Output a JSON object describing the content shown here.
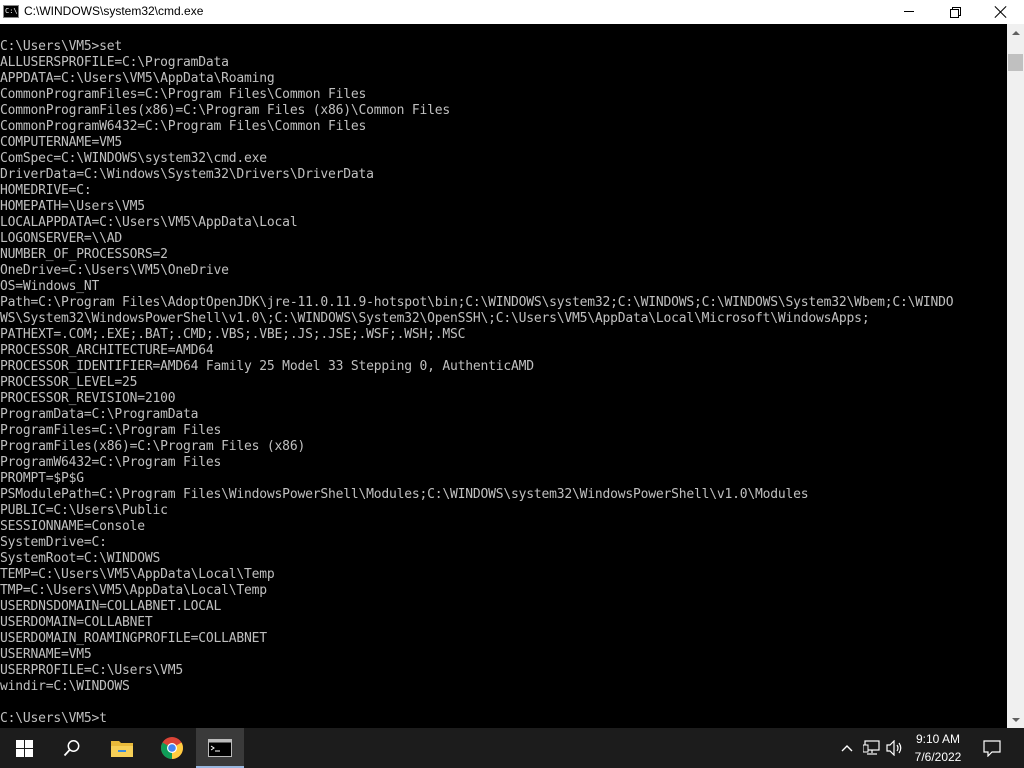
{
  "window": {
    "title": "C:\\WINDOWS\\system32\\cmd.exe",
    "icon": "cmd-icon",
    "icon_text": "C:\\"
  },
  "console": {
    "text": "C:\\Users\\VM5>set\nALLUSERSPROFILE=C:\\ProgramData\nAPPDATA=C:\\Users\\VM5\\AppData\\Roaming\nCommonProgramFiles=C:\\Program Files\\Common Files\nCommonProgramFiles(x86)=C:\\Program Files (x86)\\Common Files\nCommonProgramW6432=C:\\Program Files\\Common Files\nCOMPUTERNAME=VM5\nComSpec=C:\\WINDOWS\\system32\\cmd.exe\nDriverData=C:\\Windows\\System32\\Drivers\\DriverData\nHOMEDRIVE=C:\nHOMEPATH=\\Users\\VM5\nLOCALAPPDATA=C:\\Users\\VM5\\AppData\\Local\nLOGONSERVER=\\\\AD\nNUMBER_OF_PROCESSORS=2\nOneDrive=C:\\Users\\VM5\\OneDrive\nOS=Windows_NT\nPath=C:\\Program Files\\AdoptOpenJDK\\jre-11.0.11.9-hotspot\\bin;C:\\WINDOWS\\system32;C:\\WINDOWS;C:\\WINDOWS\\System32\\Wbem;C:\\WINDO\nWS\\System32\\WindowsPowerShell\\v1.0\\;C:\\WINDOWS\\System32\\OpenSSH\\;C:\\Users\\VM5\\AppData\\Local\\Microsoft\\WindowsApps;\nPATHEXT=.COM;.EXE;.BAT;.CMD;.VBS;.VBE;.JS;.JSE;.WSF;.WSH;.MSC\nPROCESSOR_ARCHITECTURE=AMD64\nPROCESSOR_IDENTIFIER=AMD64 Family 25 Model 33 Stepping 0, AuthenticAMD\nPROCESSOR_LEVEL=25\nPROCESSOR_REVISION=2100\nProgramData=C:\\ProgramData\nProgramFiles=C:\\Program Files\nProgramFiles(x86)=C:\\Program Files (x86)\nProgramW6432=C:\\Program Files\nPROMPT=$P$G\nPSModulePath=C:\\Program Files\\WindowsPowerShell\\Modules;C:\\WINDOWS\\system32\\WindowsPowerShell\\v1.0\\Modules\nPUBLIC=C:\\Users\\Public\nSESSIONNAME=Console\nSystemDrive=C:\nSystemRoot=C:\\WINDOWS\nTEMP=C:\\Users\\VM5\\AppData\\Local\\Temp\nTMP=C:\\Users\\VM5\\AppData\\Local\\Temp\nUSERDNSDOMAIN=COLLABNET.LOCAL\nUSERDOMAIN=COLLABNET\nUSERDOMAIN_ROAMINGPROFILE=COLLABNET\nUSERNAME=VM5\nUSERPROFILE=C:\\Users\\VM5\nwindir=C:\\WINDOWS\n\nC:\\Users\\VM5>t",
    "colors": {
      "background": "#000000",
      "foreground": "#c0c0c0"
    }
  },
  "taskbar": {
    "apps": [
      {
        "name": "start",
        "icon": "windows-logo-icon"
      },
      {
        "name": "search",
        "icon": "search-icon"
      },
      {
        "name": "file-explorer",
        "icon": "folder-icon"
      },
      {
        "name": "chrome",
        "icon": "chrome-icon"
      },
      {
        "name": "cmd",
        "icon": "terminal-icon",
        "active": true
      }
    ],
    "tray_icons": [
      "chevron-up-icon",
      "network-icon",
      "volume-icon"
    ],
    "clock": {
      "time": "9:10 AM",
      "date": "7/6/2022"
    },
    "notification_icon": "notification-icon"
  }
}
